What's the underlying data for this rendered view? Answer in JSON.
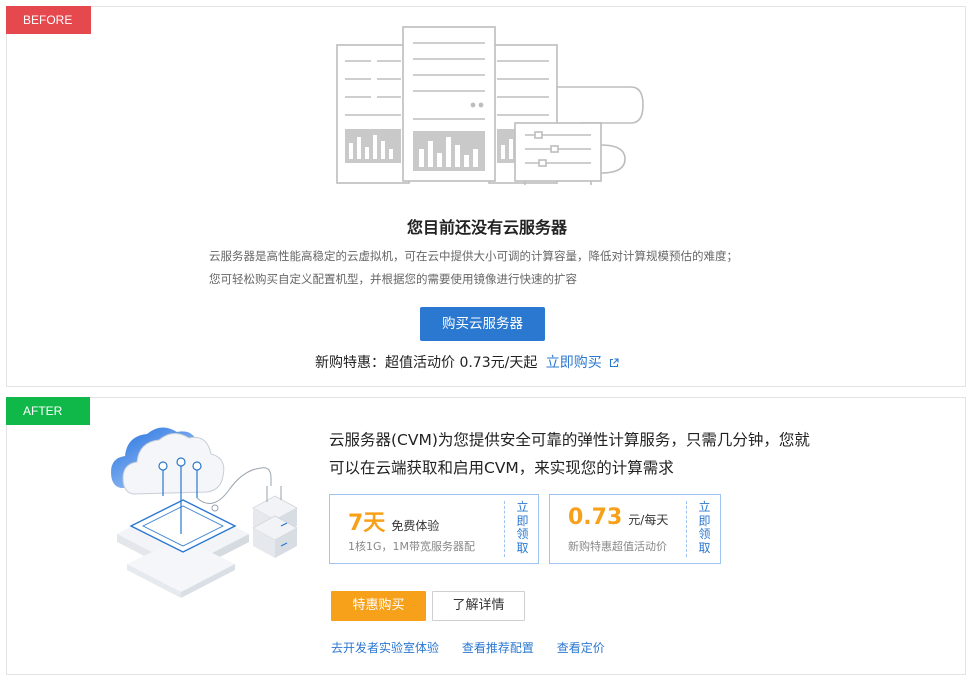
{
  "before": {
    "tag": "BEFORE",
    "empty_title": "您目前还没有云服务器",
    "desc_line1": "云服务器是高性能高稳定的云虚拟机，可在云中提供大小可调的计算容量，降低对计算规模预估的难度；",
    "desc_line2": "您可轻松购买自定义配置机型，并根据您的需要使用镜像进行快速的扩容",
    "buy_button": "购买云服务器",
    "promo_text": "新购特惠：超值活动价 0.73元/天起",
    "promo_link": "立即购买",
    "icons": [
      "server-rack-illustration",
      "external-link-icon"
    ]
  },
  "after": {
    "tag": "AFTER",
    "intro_line1": "云服务器(CVM)为您提供安全可靠的弹性计算服务，只需几分钟，您就",
    "intro_line2": "可以在云端获取和启用CVM，来实现您的计算需求",
    "cards": [
      {
        "big": "7天",
        "unit": "免费体验",
        "sub": "1核1G，1M带宽服务器配",
        "claim": [
          "立",
          "即",
          "领",
          "取"
        ]
      },
      {
        "big": "0.73",
        "unit": "元/每天",
        "sub": "新购特惠超值活动价",
        "claim": [
          "立",
          "即",
          "领",
          "取"
        ]
      }
    ],
    "special_button": "特惠购买",
    "details_button": "了解详情",
    "links": [
      "去开发者实验室体验",
      "查看推荐配置",
      "查看定价"
    ],
    "icons": [
      "cloud-network-illustration"
    ]
  },
  "colors": {
    "before_tag": "#e5484d",
    "after_tag": "#10b84a",
    "primary_blue": "#2b78d0",
    "accent_orange": "#f7a11a",
    "card_border": "#9fc4f2"
  }
}
